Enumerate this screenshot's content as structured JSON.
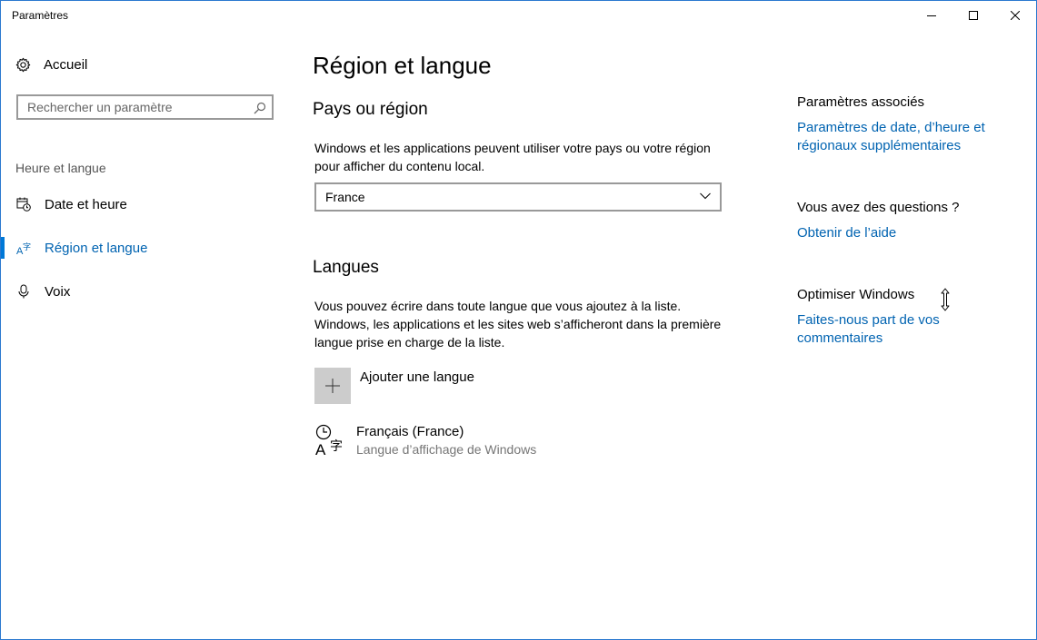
{
  "window": {
    "title": "Paramètres"
  },
  "sidebar": {
    "home_label": "Accueil",
    "search_placeholder": "Rechercher un paramètre",
    "section_label": "Heure et langue",
    "items": [
      {
        "label": "Date et heure",
        "icon": "calendar-clock-icon",
        "active": false
      },
      {
        "label": "Région et langue",
        "icon": "language-icon",
        "active": true
      },
      {
        "label": "Voix",
        "icon": "microphone-icon",
        "active": false
      }
    ]
  },
  "main": {
    "title": "Région et langue",
    "country": {
      "heading": "Pays ou région",
      "description": "Windows et les applications peuvent utiliser votre pays ou votre région pour afficher du contenu local.",
      "selected": "France"
    },
    "languages": {
      "heading": "Langues",
      "description": "Vous pouvez écrire dans toute langue que vous ajoutez à la liste. Windows, les applications et les sites web s’afficheront dans la première langue prise en charge de la liste.",
      "add_label": "Ajouter une langue",
      "items": [
        {
          "name": "Français (France)",
          "detail": "Langue d’affichage de Windows"
        }
      ]
    }
  },
  "related": {
    "heading": "Paramètres associés",
    "link": "Paramètres de date, d’heure et régionaux supplémentaires",
    "questions_heading": "Vous avez des questions ?",
    "help_link": "Obtenir de l’aide",
    "improve_heading": "Optimiser Windows",
    "feedback_link": "Faites-nous part de vos commentaires"
  },
  "colors": {
    "accent": "#0078d7",
    "link": "#0063b1",
    "window_border": "#2b79d0"
  }
}
